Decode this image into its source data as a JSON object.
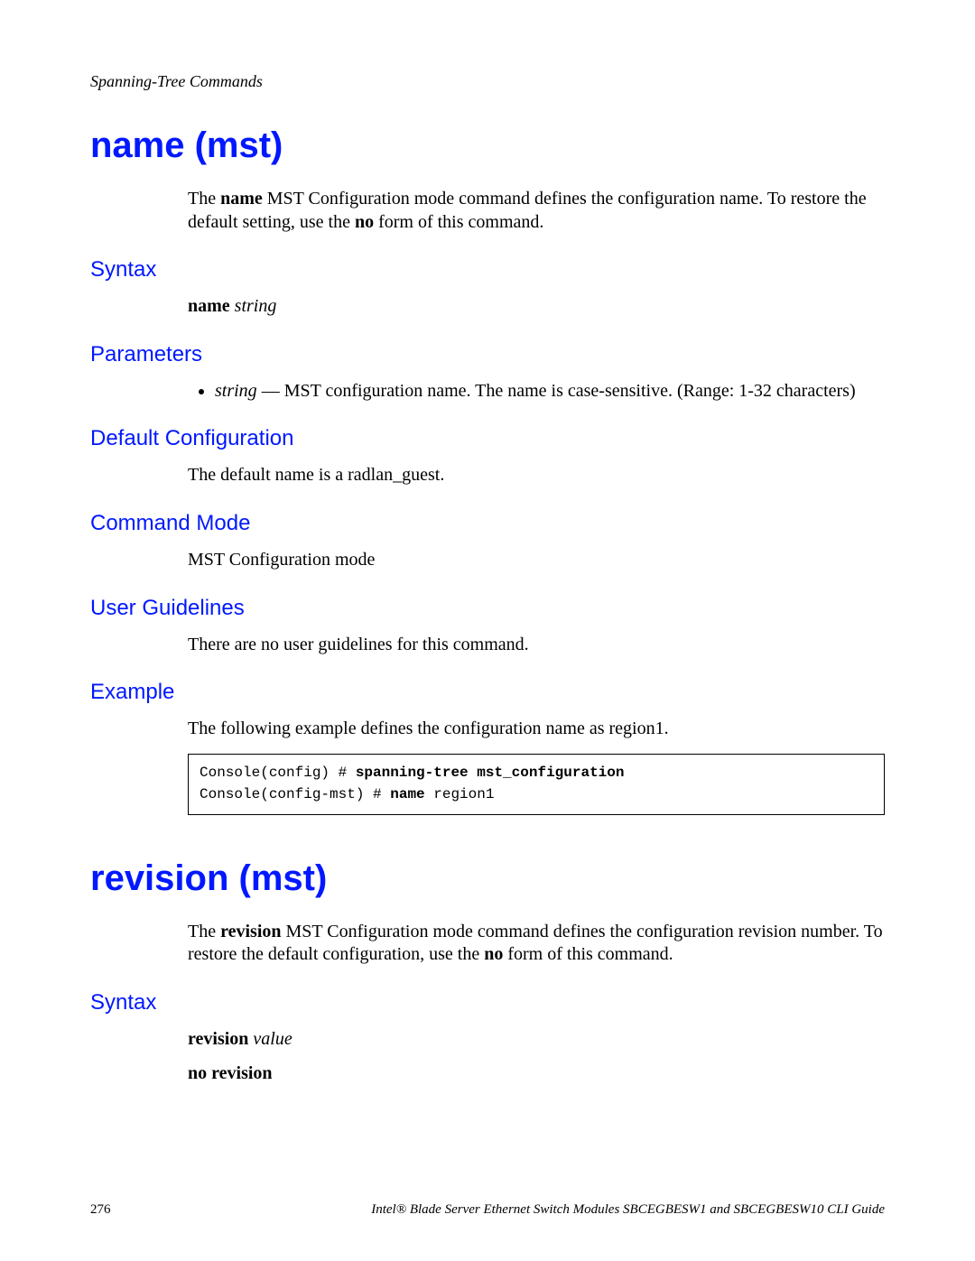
{
  "running_head": "Spanning-Tree Commands",
  "footer": {
    "page_number": "276",
    "guide_title": "Intel® Blade Server Ethernet Switch Modules SBCEGBESW1 and SBCEGBESW10 CLI Guide"
  },
  "sections": [
    {
      "title": "name (mst)",
      "intro_parts": [
        {
          "t": "The "
        },
        {
          "t": "name",
          "b": true
        },
        {
          "t": " MST Configuration mode command defines the configuration name. To restore the default setting, use the "
        },
        {
          "t": "no",
          "b": true
        },
        {
          "t": " form of this command."
        }
      ],
      "subsections": [
        {
          "heading": "Syntax",
          "syntax_lines": [
            [
              {
                "t": "name ",
                "b": true
              },
              {
                "t": "string",
                "i": true
              }
            ]
          ]
        },
        {
          "heading": "Parameters",
          "params": [
            [
              {
                "t": "string",
                "i": true
              },
              {
                "t": " — MST configuration name. The name is case-sensitive. (Range: 1-32 characters)"
              }
            ]
          ]
        },
        {
          "heading": "Default Configuration",
          "plain": "The default name is a radlan_guest."
        },
        {
          "heading": "Command Mode",
          "plain": "MST Configuration mode"
        },
        {
          "heading": "User Guidelines",
          "plain": "There are no user guidelines for this command."
        },
        {
          "heading": "Example",
          "plain": "The following example defines the configuration name as region1.",
          "code_lines": [
            [
              {
                "t": "Console(config) # "
              },
              {
                "t": "spanning-tree mst_configuration",
                "b": true
              }
            ],
            [
              {
                "t": "Console(config-mst) # "
              },
              {
                "t": "name ",
                "b": true
              },
              {
                "t": "region1"
              }
            ]
          ]
        }
      ]
    },
    {
      "title": "revision (mst)",
      "intro_parts": [
        {
          "t": "The "
        },
        {
          "t": "revision",
          "b": true
        },
        {
          "t": " MST Configuration mode command defines the configuration revision number. To restore the default configuration, use the "
        },
        {
          "t": "no",
          "b": true
        },
        {
          "t": " form of this command."
        }
      ],
      "subsections": [
        {
          "heading": "Syntax",
          "syntax_lines": [
            [
              {
                "t": "revision ",
                "b": true
              },
              {
                "t": "value",
                "i": true
              }
            ],
            [
              {
                "t": "no revision",
                "b": true
              }
            ]
          ]
        }
      ]
    }
  ]
}
